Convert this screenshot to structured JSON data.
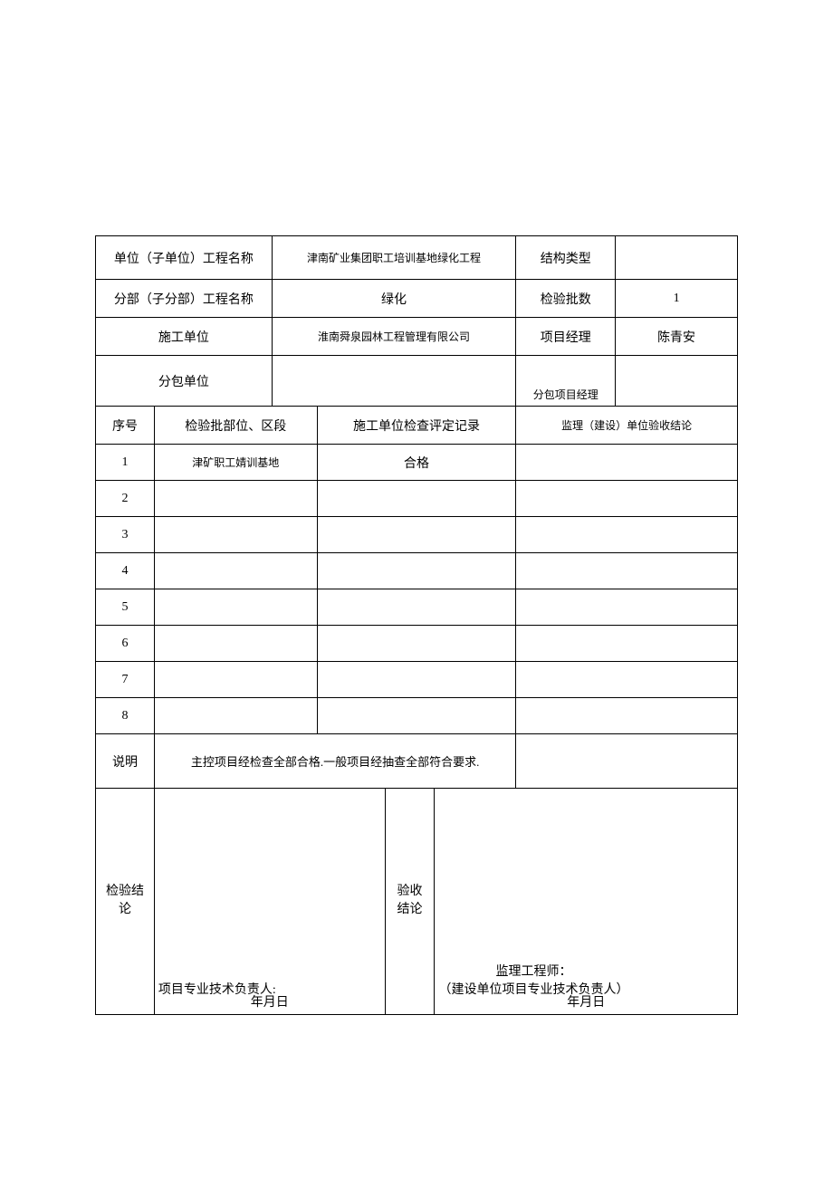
{
  "header": {
    "row1_label": "单位（子单位）工程名称",
    "row1_value": "津南矿业集团职工培训基地绿化工程",
    "row1_label2": "结构类型",
    "row1_value2": "",
    "row2_label": "分部（子分部）工程名称",
    "row2_value": "绿化",
    "row2_label2": "检验批数",
    "row2_value2": "1",
    "row3_label": "施工单位",
    "row3_value": "淮南舜泉园林工程管理有限公司",
    "row3_label2": "项目经理",
    "row3_value2": "陈青安",
    "row4_label": "分包单位",
    "row4_value": "",
    "row4_label2": "分包项目经理",
    "row4_value2": ""
  },
  "columns": {
    "c1": "序号",
    "c2": "检验批部位、区段",
    "c3": "施工单位检查评定记录",
    "c4": "监理（建设）单位验收结论"
  },
  "rows": [
    {
      "num": "1",
      "part": "津矿职工婧训基地",
      "record": "合格",
      "concl": ""
    },
    {
      "num": "2",
      "part": "",
      "record": "",
      "concl": ""
    },
    {
      "num": "3",
      "part": "",
      "record": "",
      "concl": ""
    },
    {
      "num": "4",
      "part": "",
      "record": "",
      "concl": ""
    },
    {
      "num": "5",
      "part": "",
      "record": "",
      "concl": ""
    },
    {
      "num": "6",
      "part": "",
      "record": "",
      "concl": ""
    },
    {
      "num": "7",
      "part": "",
      "record": "",
      "concl": ""
    },
    {
      "num": "8",
      "part": "",
      "record": "",
      "concl": ""
    }
  ],
  "desc": {
    "label": "说明",
    "text": "主控项目经检查全部合格.一般项目经抽查全部符合要求."
  },
  "conclusion": {
    "left_label": "检验结\n论",
    "left_label_l1": "检验结",
    "left_label_l2": "论",
    "left_title": "项目专业技术负责人:",
    "left_date": "年月日",
    "right_label": "验收\n结论",
    "right_label_l1": "验收",
    "right_label_l2": "结论",
    "right_title1": "监理工程师：",
    "right_title2": "（建设单位项目专业技术负责人）",
    "right_date": "年月日"
  }
}
